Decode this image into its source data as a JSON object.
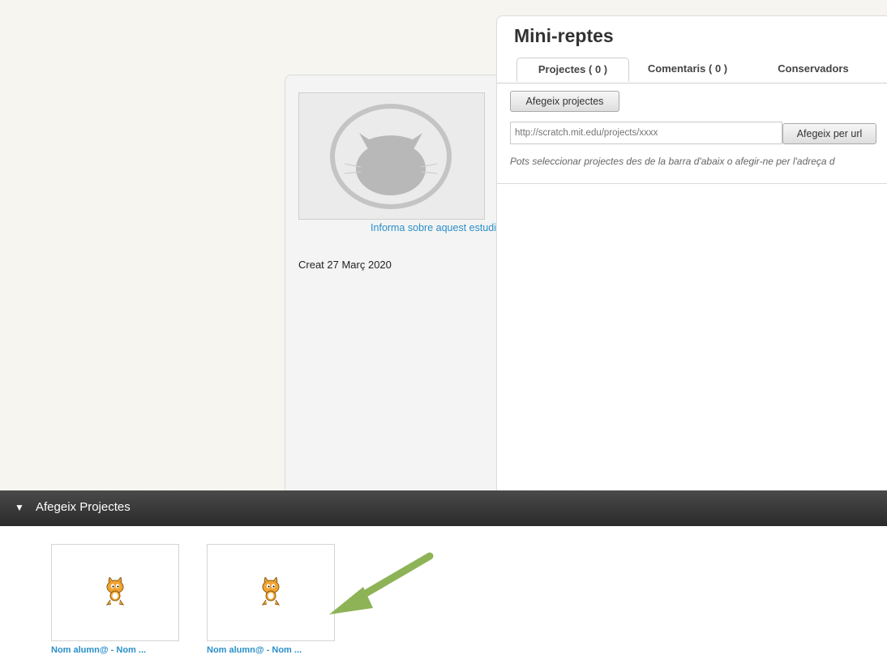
{
  "studio": {
    "title": "Mini-reptes",
    "report_link": "Informa sobre aquest estudi",
    "created": "Creat 27 Març 2020"
  },
  "tabs": [
    {
      "label": "Projectes ( 0 )",
      "active": true
    },
    {
      "label": "Comentaris ( 0 )",
      "active": false
    },
    {
      "label": "Conservadors",
      "active": false
    }
  ],
  "actions": {
    "add_projects": "Afegeix projectes",
    "url_placeholder": "http://scratch.mit.edu/projects/xxxx",
    "add_by_url": "Afegeix per url",
    "help_text": "Pots seleccionar projectes des de la barra d'abaix o afegir-ne per l'adreça d"
  },
  "tray": {
    "toggle_icon": "triangle-down-icon",
    "title": "Afegeix Projectes",
    "projects": [
      {
        "title": "Nom alumn@ - Nom ..."
      },
      {
        "title": "Nom alumn@ - Nom ..."
      }
    ]
  },
  "colors": {
    "link": "#2a8fc9",
    "tray_bar": "#333333",
    "annotation_arrow": "#8db356"
  }
}
